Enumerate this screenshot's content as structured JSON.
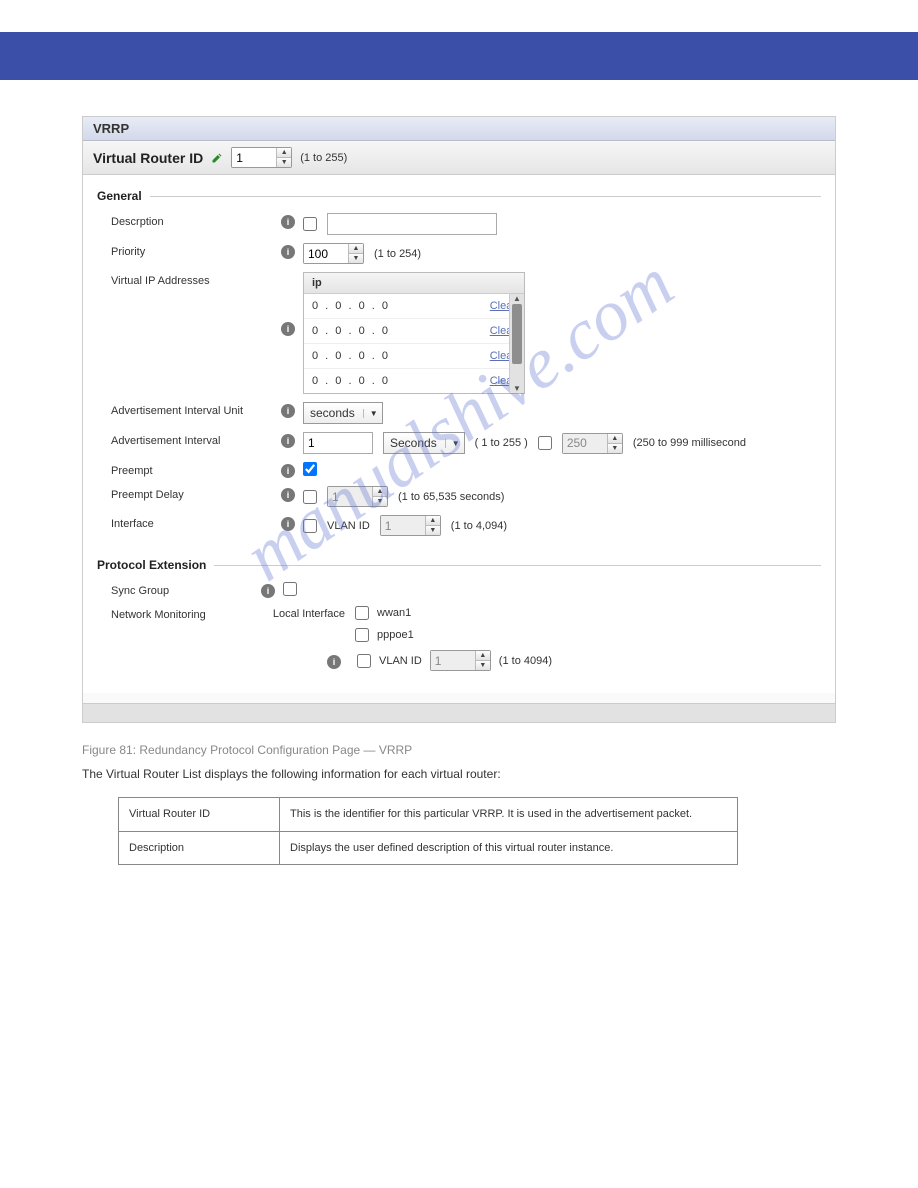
{
  "panel": {
    "title": "VRRP"
  },
  "vrid": {
    "label": "Virtual Router ID",
    "value": "1",
    "hint": "(1 to 255)"
  },
  "general": {
    "heading": "General",
    "description": {
      "label": "Descrption",
      "value": ""
    },
    "priority": {
      "label": "Priority",
      "value": "100",
      "hint": "(1 to 254)"
    },
    "vip": {
      "label": "Virtual IP Addresses",
      "col": "ip",
      "rows": [
        {
          "ip": "0 . 0 . 0 . 0",
          "clear": "Clear"
        },
        {
          "ip": "0 . 0 . 0 . 0",
          "clear": "Clear"
        },
        {
          "ip": "0 . 0 . 0 . 0",
          "clear": "Clear"
        },
        {
          "ip": "0 . 0 . 0 . 0",
          "clear": "Clear"
        }
      ]
    },
    "adv_unit": {
      "label": "Advertisement Interval Unit",
      "value": "seconds"
    },
    "adv_int": {
      "label": "Advertisement Interval",
      "value": "1",
      "unit": "Seconds",
      "hint1": "( 1 to 255 )",
      "ms_value": "250",
      "hint2": "(250 to 999 millisecond"
    },
    "preempt": {
      "label": "Preempt"
    },
    "preempt_delay": {
      "label": "Preempt Delay",
      "value": "1",
      "hint": "(1 to 65,535 seconds)"
    },
    "interface": {
      "label": "Interface",
      "vlan_label": "VLAN ID",
      "value": "1",
      "hint": "(1 to 4,094)"
    }
  },
  "ext": {
    "heading": "Protocol Extension",
    "sync": {
      "label": "Sync Group"
    },
    "netmon": {
      "label": "Network Monitoring",
      "sublabel": "Local Interface",
      "opts": {
        "wwan1": "wwan1",
        "pppoe1": "pppoe1",
        "vlan_label": "VLAN ID",
        "vlan_value": "1",
        "vlan_hint": "(1 to 4094)"
      }
    }
  },
  "watermark": "manualshive.com",
  "guide": {
    "caption_sub": "Figure 81: Redundancy Protocol Configuration Page — VRRP",
    "intro": "The Virtual Router List displays the following information for each virtual router:",
    "rows": [
      {
        "param": "Virtual Router ID",
        "desc": "This is the identifier for this particular VRRP. It is used in the advertisement packet."
      },
      {
        "param": "Description",
        "desc": "Displays the user defined description of this virtual router instance."
      }
    ]
  }
}
